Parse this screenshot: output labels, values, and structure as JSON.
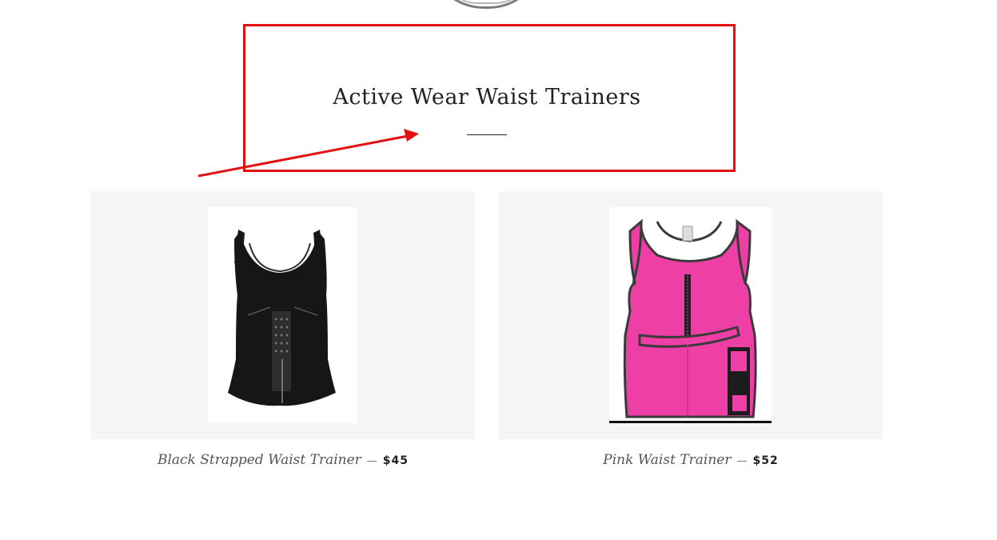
{
  "section": {
    "title": "Active Wear Waist Trainers"
  },
  "annotation": {
    "color": "#e31111"
  },
  "products": [
    {
      "name": "Black Strapped Waist Trainer",
      "separator": "—",
      "price": "$45",
      "image": "black-waist-trainer-vest"
    },
    {
      "name": "Pink Waist Trainer",
      "separator": "—",
      "price": "$52",
      "image": "pink-waist-trainer-vest"
    }
  ],
  "colors": {
    "card_background": "#f5f5f5",
    "title_text": "#222222",
    "pink_product": "#ee3fa6"
  }
}
